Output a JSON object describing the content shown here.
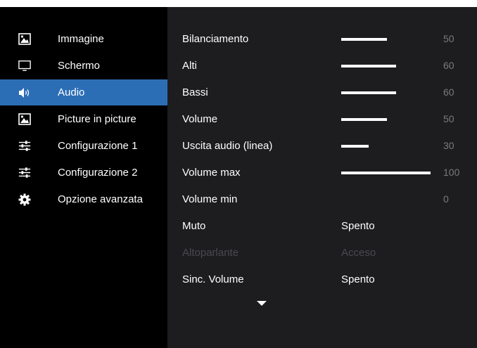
{
  "sidebar": {
    "items": [
      {
        "label": "Immagine",
        "icon": "picture-icon",
        "active": false
      },
      {
        "label": "Schermo",
        "icon": "monitor-icon",
        "active": false
      },
      {
        "label": "Audio",
        "icon": "speaker-icon",
        "active": true
      },
      {
        "label": "Picture in picture",
        "icon": "picture-icon",
        "active": false
      },
      {
        "label": "Configurazione 1",
        "icon": "sliders-icon",
        "active": false
      },
      {
        "label": "Configurazione 2",
        "icon": "sliders-icon",
        "active": false
      },
      {
        "label": "Opzione avanzata",
        "icon": "gear-icon",
        "active": false
      }
    ]
  },
  "audio": {
    "settings": [
      {
        "label": "Bilanciamento",
        "type": "slider",
        "value": 50
      },
      {
        "label": "Alti",
        "type": "slider",
        "value": 60
      },
      {
        "label": "Bassi",
        "type": "slider",
        "value": 60
      },
      {
        "label": "Volume",
        "type": "slider",
        "value": 50
      },
      {
        "label": "Uscita audio (linea)",
        "type": "slider",
        "value": 30
      },
      {
        "label": "Volume max",
        "type": "slider",
        "value": 100
      },
      {
        "label": "Volume min",
        "type": "slider",
        "value": 0
      },
      {
        "label": "Muto",
        "type": "option",
        "value": "Spento"
      },
      {
        "label": "Altoparlante",
        "type": "option",
        "value": "Acceso",
        "disabled": true
      },
      {
        "label": "Sinc. Volume",
        "type": "option",
        "value": "Spento"
      }
    ]
  },
  "colors": {
    "active": "#2c6eb6",
    "sidebar_bg": "#000000",
    "panel_bg": "#1d1d20",
    "muted_text": "#7a7a7a",
    "disabled_text": "#4a4a4e"
  }
}
